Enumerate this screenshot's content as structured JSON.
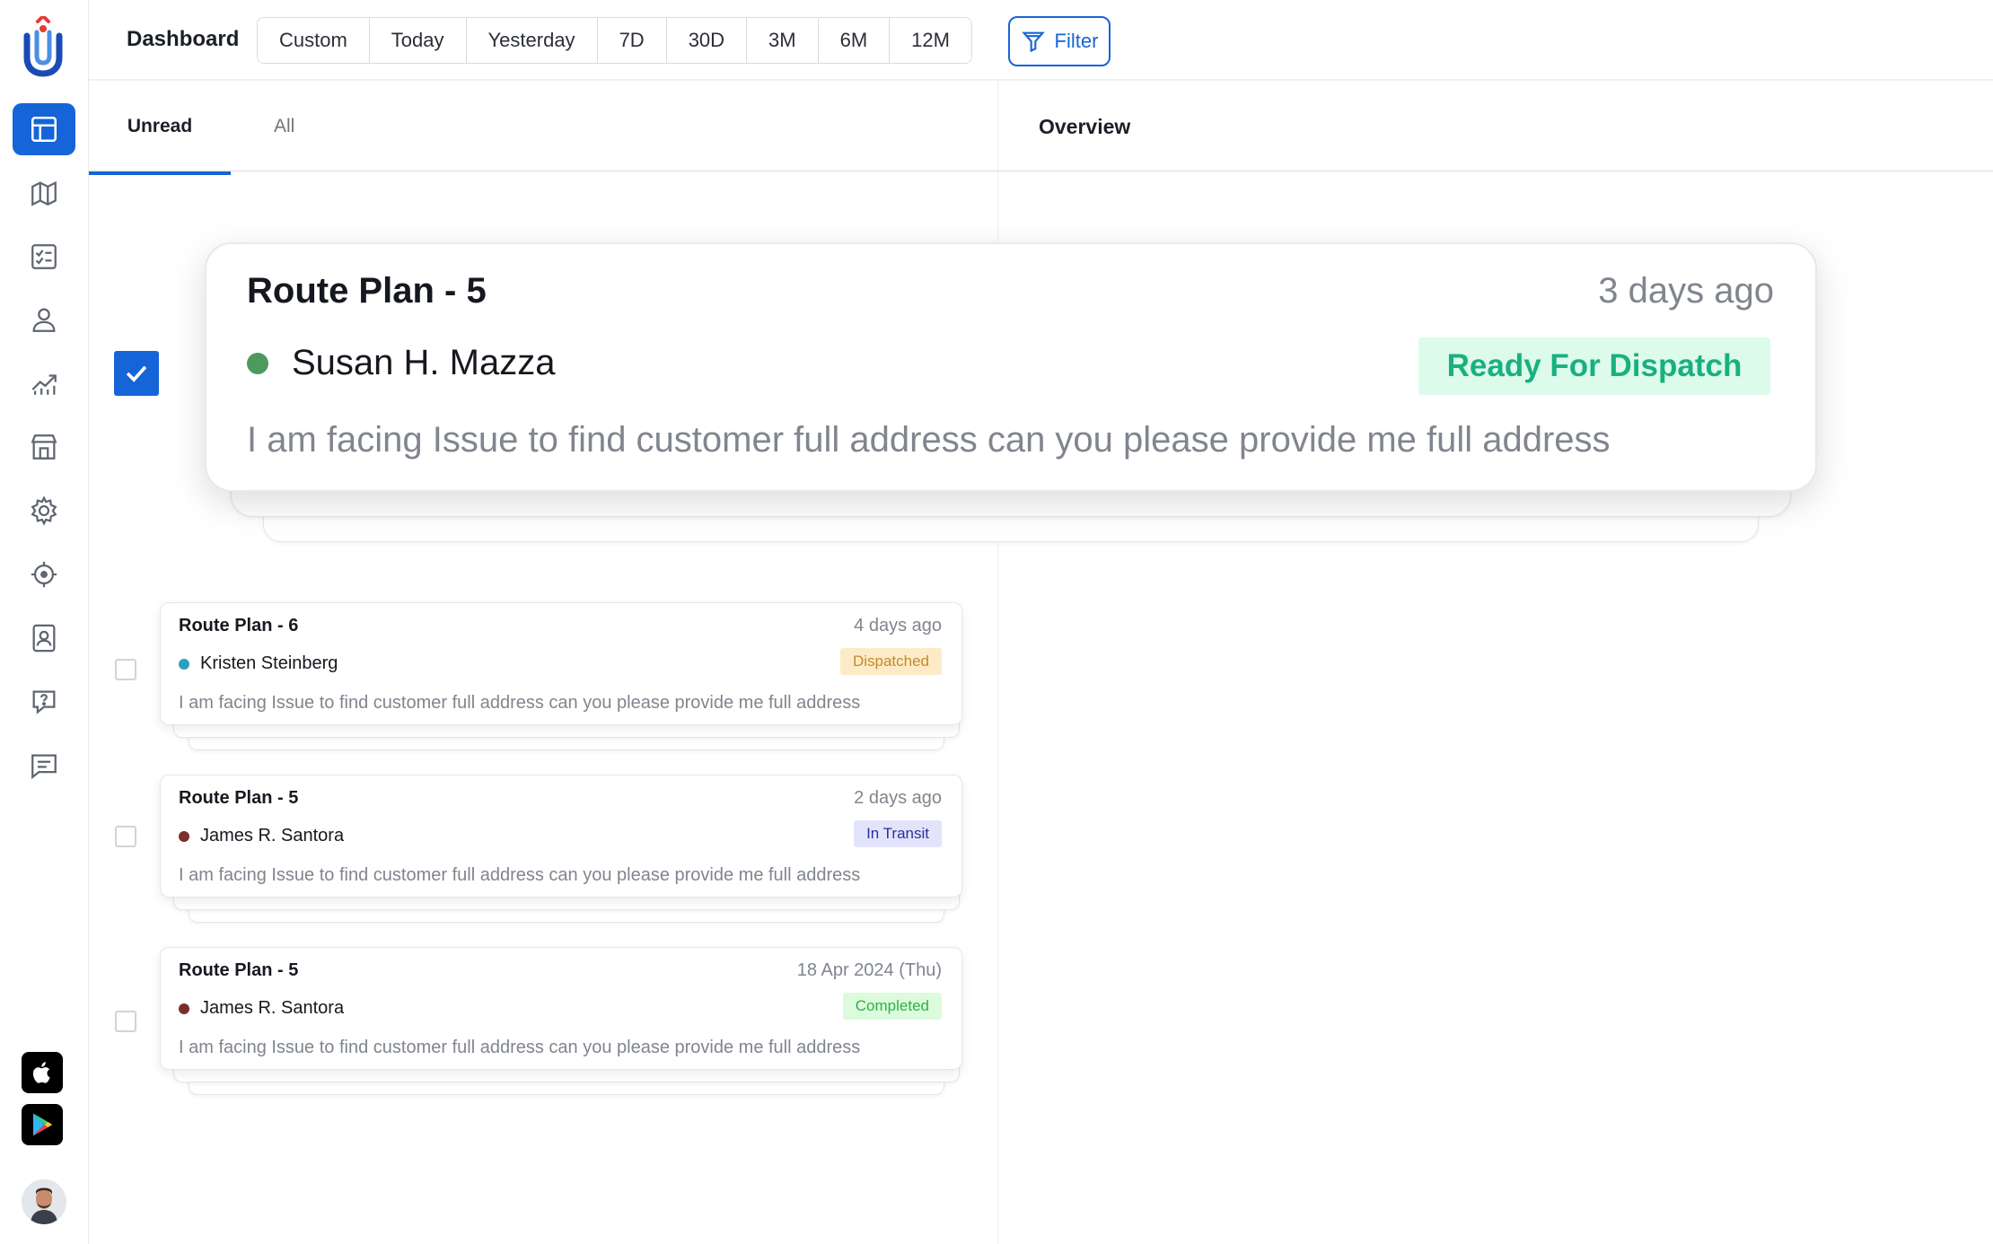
{
  "app": {
    "page_title": "Dashboard"
  },
  "toolbar": {
    "ranges": [
      "Custom",
      "Today",
      "Yesterday",
      "7D",
      "30D",
      "3M",
      "6M",
      "12M"
    ],
    "filter_label": "Filter"
  },
  "tabs": {
    "unread": "Unread",
    "all": "All",
    "active": "Unread"
  },
  "overview": {
    "title": "Overview"
  },
  "featured": {
    "title": "Route Plan - 5",
    "time": "3 days ago",
    "person": "Susan H. Mazza",
    "dot_color": "#4e9a5e",
    "status": "Ready For Dispatch",
    "status_bg": "#dcfbea",
    "status_fg": "#19b081",
    "message": "I am facing Issue to find customer full address can you please provide me full address",
    "checked": true
  },
  "cards": [
    {
      "title": "Route Plan - 6",
      "time": "4 days ago",
      "person": "Kristen Steinberg",
      "dot_color": "#2a9fbe",
      "status": "Dispatched",
      "status_bg": "#fdebc8",
      "status_fg": "#c48a2a",
      "message": "I am facing Issue to find customer full address can you please provide me full address"
    },
    {
      "title": "Route Plan - 5",
      "time": "2 days ago",
      "person": "James R. Santora",
      "dot_color": "#7a2f2f",
      "status": "In Transit",
      "status_bg": "#e3e4fb",
      "status_fg": "#2b2f9c",
      "message": "I am facing Issue to find customer full address can you please provide me full address"
    },
    {
      "title": "Route Plan - 5",
      "time": "18 Apr 2024 (Thu)",
      "person": "James R. Santora",
      "dot_color": "#7a2f2f",
      "status": "Completed",
      "status_bg": "#dcfbdc",
      "status_fg": "#2fb044",
      "message": "I am facing Issue to find customer full address can you please provide me full address"
    }
  ],
  "sidebar": {
    "items": [
      {
        "icon": "dashboard-icon",
        "active": true
      },
      {
        "icon": "map-icon",
        "active": false
      },
      {
        "icon": "checklist-icon",
        "active": false
      },
      {
        "icon": "users-icon",
        "active": false
      },
      {
        "icon": "analytics-icon",
        "active": false
      },
      {
        "icon": "store-icon",
        "active": false
      },
      {
        "icon": "settings-icon",
        "active": false
      },
      {
        "icon": "tracking-icon",
        "active": false
      },
      {
        "icon": "contacts-icon",
        "active": false
      },
      {
        "icon": "help-icon",
        "active": false
      },
      {
        "icon": "chat-icon",
        "active": false
      }
    ],
    "stores": [
      "apple-icon",
      "google-play-icon"
    ]
  },
  "colors": {
    "accent": "#1565d8",
    "icon": "#5f6670"
  }
}
